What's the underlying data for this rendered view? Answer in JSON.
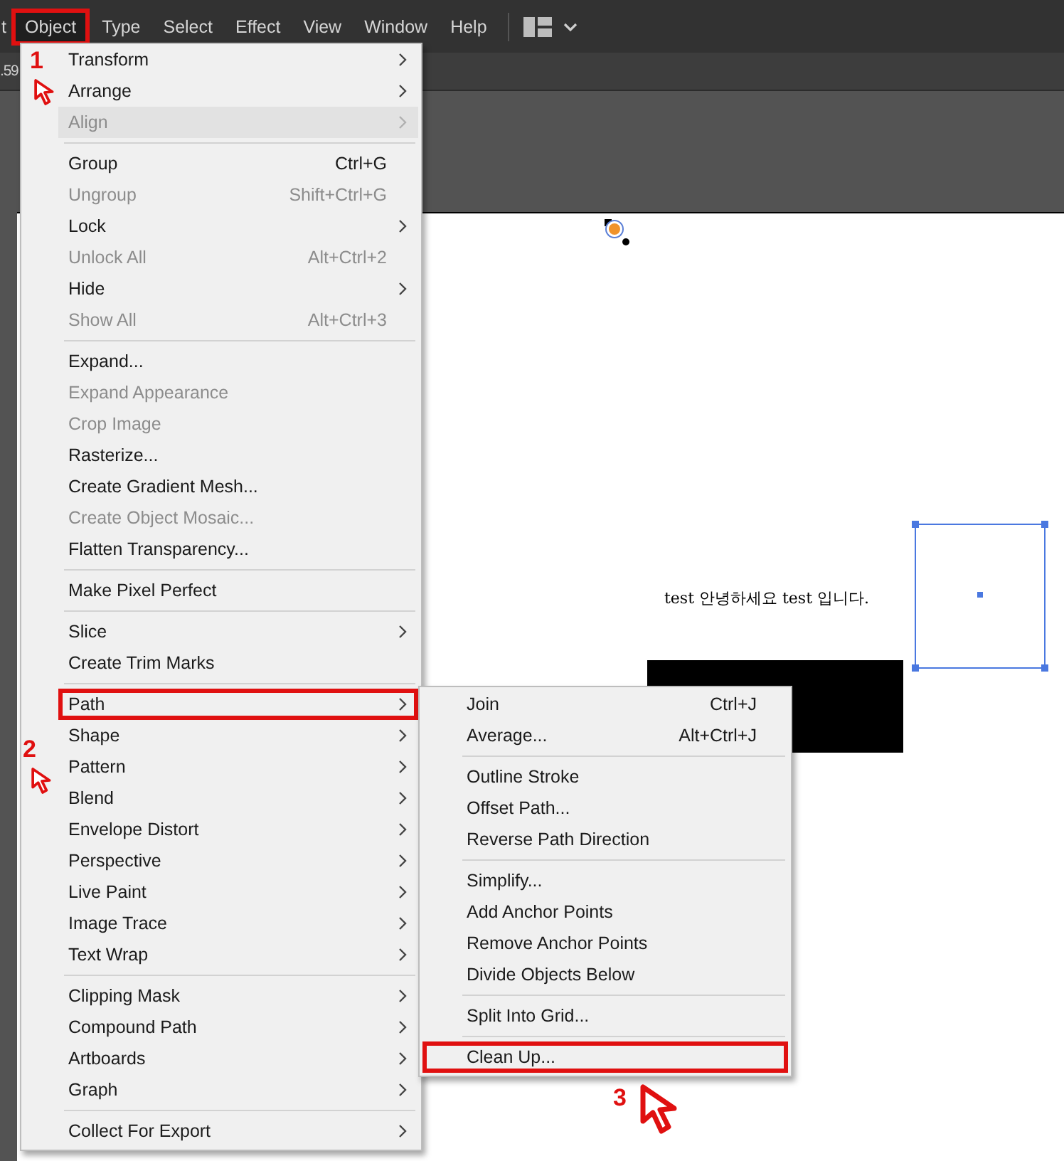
{
  "menubar": {
    "clipped_left": "t",
    "items": [
      {
        "label": "Object",
        "selected": true,
        "annotated": true
      },
      {
        "label": "Type",
        "selected": false,
        "annotated": false
      },
      {
        "label": "Select",
        "selected": false,
        "annotated": false
      },
      {
        "label": "Effect",
        "selected": false,
        "annotated": false
      },
      {
        "label": "View",
        "selected": false,
        "annotated": false
      },
      {
        "label": "Window",
        "selected": false,
        "annotated": false
      },
      {
        "label": "Help",
        "selected": false,
        "annotated": false
      }
    ]
  },
  "control_bar": {
    "clipped_value": ".59"
  },
  "object_menu": {
    "items": [
      {
        "kind": "item",
        "label": "Transform",
        "submenu": true,
        "disabled": false,
        "selected": false,
        "annotated": false
      },
      {
        "kind": "item",
        "label": "Arrange",
        "submenu": true,
        "disabled": false,
        "selected": false,
        "annotated": false
      },
      {
        "kind": "item",
        "label": "Align",
        "submenu": true,
        "disabled": true,
        "selected": true,
        "annotated": false
      },
      {
        "kind": "separator"
      },
      {
        "kind": "item",
        "label": "Group",
        "shortcut": "Ctrl+G",
        "submenu": false,
        "disabled": false,
        "selected": false,
        "annotated": false
      },
      {
        "kind": "item",
        "label": "Ungroup",
        "shortcut": "Shift+Ctrl+G",
        "submenu": false,
        "disabled": true,
        "selected": false,
        "annotated": false
      },
      {
        "kind": "item",
        "label": "Lock",
        "submenu": true,
        "disabled": false,
        "selected": false,
        "annotated": false
      },
      {
        "kind": "item",
        "label": "Unlock All",
        "shortcut": "Alt+Ctrl+2",
        "submenu": false,
        "disabled": true,
        "selected": false,
        "annotated": false
      },
      {
        "kind": "item",
        "label": "Hide",
        "submenu": true,
        "disabled": false,
        "selected": false,
        "annotated": false
      },
      {
        "kind": "item",
        "label": "Show All",
        "shortcut": "Alt+Ctrl+3",
        "submenu": false,
        "disabled": true,
        "selected": false,
        "annotated": false
      },
      {
        "kind": "separator"
      },
      {
        "kind": "item",
        "label": "Expand...",
        "submenu": false,
        "disabled": false,
        "selected": false,
        "annotated": false
      },
      {
        "kind": "item",
        "label": "Expand Appearance",
        "submenu": false,
        "disabled": true,
        "selected": false,
        "annotated": false
      },
      {
        "kind": "item",
        "label": "Crop Image",
        "submenu": false,
        "disabled": true,
        "selected": false,
        "annotated": false
      },
      {
        "kind": "item",
        "label": "Rasterize...",
        "submenu": false,
        "disabled": false,
        "selected": false,
        "annotated": false
      },
      {
        "kind": "item",
        "label": "Create Gradient Mesh...",
        "submenu": false,
        "disabled": false,
        "selected": false,
        "annotated": false
      },
      {
        "kind": "item",
        "label": "Create Object Mosaic...",
        "submenu": false,
        "disabled": true,
        "selected": false,
        "annotated": false
      },
      {
        "kind": "item",
        "label": "Flatten Transparency...",
        "submenu": false,
        "disabled": false,
        "selected": false,
        "annotated": false
      },
      {
        "kind": "separator"
      },
      {
        "kind": "item",
        "label": "Make Pixel Perfect",
        "submenu": false,
        "disabled": false,
        "selected": false,
        "annotated": false
      },
      {
        "kind": "separator"
      },
      {
        "kind": "item",
        "label": "Slice",
        "submenu": true,
        "disabled": false,
        "selected": false,
        "annotated": false
      },
      {
        "kind": "item",
        "label": "Create Trim Marks",
        "submenu": false,
        "disabled": false,
        "selected": false,
        "annotated": false
      },
      {
        "kind": "separator"
      },
      {
        "kind": "item",
        "label": "Path",
        "submenu": true,
        "disabled": false,
        "selected": false,
        "annotated": true
      },
      {
        "kind": "item",
        "label": "Shape",
        "submenu": true,
        "disabled": false,
        "selected": false,
        "annotated": false
      },
      {
        "kind": "item",
        "label": "Pattern",
        "submenu": true,
        "disabled": false,
        "selected": false,
        "annotated": false
      },
      {
        "kind": "item",
        "label": "Blend",
        "submenu": true,
        "disabled": false,
        "selected": false,
        "annotated": false
      },
      {
        "kind": "item",
        "label": "Envelope Distort",
        "submenu": true,
        "disabled": false,
        "selected": false,
        "annotated": false
      },
      {
        "kind": "item",
        "label": "Perspective",
        "submenu": true,
        "disabled": false,
        "selected": false,
        "annotated": false
      },
      {
        "kind": "item",
        "label": "Live Paint",
        "submenu": true,
        "disabled": false,
        "selected": false,
        "annotated": false
      },
      {
        "kind": "item",
        "label": "Image Trace",
        "submenu": true,
        "disabled": false,
        "selected": false,
        "annotated": false
      },
      {
        "kind": "item",
        "label": "Text Wrap",
        "submenu": true,
        "disabled": false,
        "selected": false,
        "annotated": false
      },
      {
        "kind": "separator"
      },
      {
        "kind": "item",
        "label": "Clipping Mask",
        "submenu": true,
        "disabled": false,
        "selected": false,
        "annotated": false
      },
      {
        "kind": "item",
        "label": "Compound Path",
        "submenu": true,
        "disabled": false,
        "selected": false,
        "annotated": false
      },
      {
        "kind": "item",
        "label": "Artboards",
        "submenu": true,
        "disabled": false,
        "selected": false,
        "annotated": false
      },
      {
        "kind": "item",
        "label": "Graph",
        "submenu": true,
        "disabled": false,
        "selected": false,
        "annotated": false
      },
      {
        "kind": "separator"
      },
      {
        "kind": "item",
        "label": "Collect For Export",
        "submenu": true,
        "disabled": false,
        "selected": false,
        "annotated": false
      }
    ]
  },
  "path_submenu": {
    "items": [
      {
        "kind": "item",
        "label": "Join",
        "shortcut": "Ctrl+J",
        "submenu": false,
        "disabled": false,
        "selected": false,
        "annotated": false
      },
      {
        "kind": "item",
        "label": "Average...",
        "shortcut": "Alt+Ctrl+J",
        "submenu": false,
        "disabled": false,
        "selected": false,
        "annotated": false
      },
      {
        "kind": "separator"
      },
      {
        "kind": "item",
        "label": "Outline Stroke",
        "submenu": false,
        "disabled": false,
        "selected": false,
        "annotated": false
      },
      {
        "kind": "item",
        "label": "Offset Path...",
        "submenu": false,
        "disabled": false,
        "selected": false,
        "annotated": false
      },
      {
        "kind": "item",
        "label": "Reverse Path Direction",
        "submenu": false,
        "disabled": false,
        "selected": false,
        "annotated": false
      },
      {
        "kind": "separator"
      },
      {
        "kind": "item",
        "label": "Simplify...",
        "submenu": false,
        "disabled": false,
        "selected": false,
        "annotated": false
      },
      {
        "kind": "item",
        "label": "Add Anchor Points",
        "submenu": false,
        "disabled": false,
        "selected": false,
        "annotated": false
      },
      {
        "kind": "item",
        "label": "Remove Anchor Points",
        "submenu": false,
        "disabled": false,
        "selected": false,
        "annotated": false
      },
      {
        "kind": "item",
        "label": "Divide Objects Below",
        "submenu": false,
        "disabled": false,
        "selected": false,
        "annotated": false
      },
      {
        "kind": "separator"
      },
      {
        "kind": "item",
        "label": "Split Into Grid...",
        "submenu": false,
        "disabled": false,
        "selected": false,
        "annotated": false
      },
      {
        "kind": "separator"
      },
      {
        "kind": "item",
        "label": "Clean Up...",
        "submenu": false,
        "disabled": false,
        "selected": false,
        "annotated": true
      }
    ]
  },
  "canvas": {
    "text": "test 안녕하세요 test 입니다."
  },
  "annotations": [
    {
      "label": "1"
    },
    {
      "label": "2"
    },
    {
      "label": "3"
    }
  ]
}
